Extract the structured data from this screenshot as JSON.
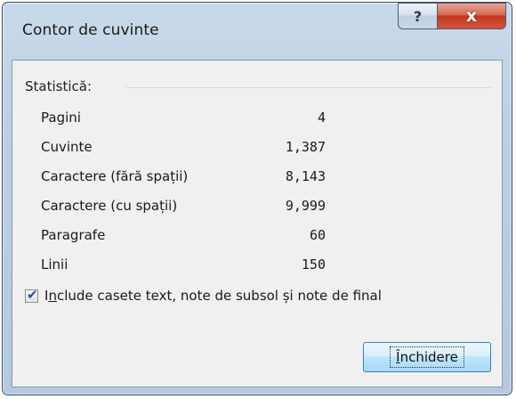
{
  "window": {
    "title": "Contor de cuvinte",
    "help_glyph": "?",
    "close_glyph": "x"
  },
  "statistics": {
    "group_label": "Statistică:",
    "rows": [
      {
        "label": "Pagini",
        "value": "4"
      },
      {
        "label": "Cuvinte",
        "value": "1,387"
      },
      {
        "label": "Caractere (fără spații)",
        "value": "8,143"
      },
      {
        "label": "Caractere (cu spații)",
        "value": "9,999"
      },
      {
        "label": "Paragrafe",
        "value": "60"
      },
      {
        "label": "Linii",
        "value": "150"
      }
    ]
  },
  "include_option": {
    "checked": true,
    "label_prefix": "I",
    "label_accel": "n",
    "label_rest": "clude casete text, note de subsol și note de final"
  },
  "close_button": {
    "label_accel": "Î",
    "label_rest": "nchidere"
  }
}
